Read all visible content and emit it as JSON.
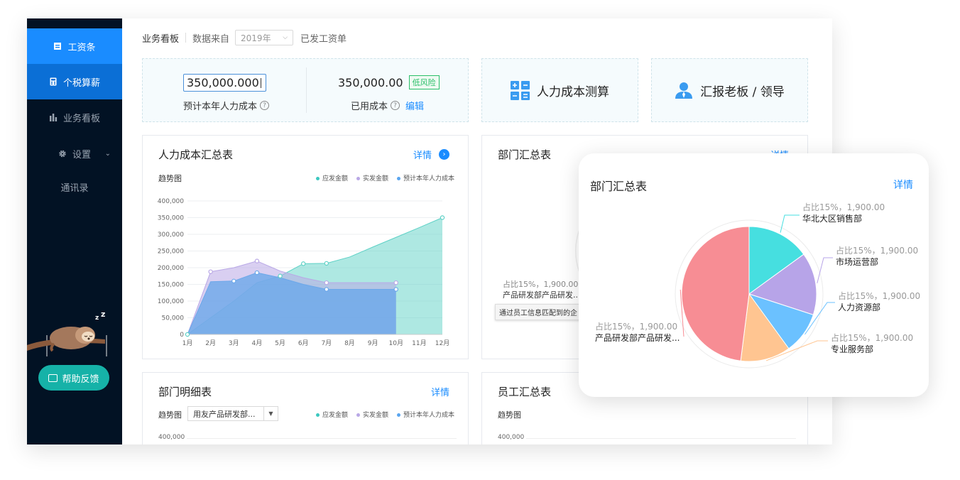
{
  "sidebar": {
    "items": [
      {
        "label": "工资条",
        "icon": "payslip-icon"
      },
      {
        "label": "个税算薪",
        "icon": "calculator-icon"
      },
      {
        "label": "业务看板",
        "icon": "bar-chart-icon"
      },
      {
        "label": "设置",
        "icon": "gear-icon"
      },
      {
        "label": "通讯录",
        "icon": ""
      }
    ],
    "help_label": "帮助反馈"
  },
  "topbar": {
    "title": "业务看板",
    "source_label": "数据来自",
    "year": "2019年",
    "paid_label": "已发工资单"
  },
  "summary": {
    "estimate_value": "350,000.000",
    "estimate_label": "预计本年人力成本",
    "used_value": "350,000.00",
    "risk_badge": "低风险",
    "used_label": "已用成本",
    "edit_label": "编辑",
    "calc_label": "人力成本测算",
    "report_label": "汇报老板 / 领导"
  },
  "cost_card": {
    "title": "人力成本汇总表",
    "detail": "详情",
    "subtitle": "趋势图",
    "legend": [
      "应发金额",
      "实发金额",
      "预计本年人力成本"
    ]
  },
  "dept_card": {
    "title": "部门汇总表",
    "detail": "详情",
    "pct_label": "占比15%，1,900.00",
    "name_label": "产品研发部产品研发...",
    "tooltip": "通过员工信息匹配到的企"
  },
  "dept_detail_card": {
    "title": "部门明细表",
    "detail": "详情",
    "subtitle": "趋势图",
    "select_value": "用友产品研发部...",
    "legend": [
      "应发金额",
      "实发金额",
      "预计本年人力成本"
    ],
    "y_top": "400,000"
  },
  "staff_card": {
    "title": "员工汇总表",
    "subtitle": "趋势图",
    "y_top": "400,000"
  },
  "popup": {
    "title": "部门汇总表",
    "detail": "详情"
  },
  "colors": {
    "sidebar_bg": "#021224",
    "active_blue": "#1a8cff",
    "help_green": "#16b2a8",
    "teal": "#5ed1c6",
    "purple": "#b9a8e6",
    "blue": "#6ca8ea"
  },
  "chart_data": [
    {
      "type": "area",
      "title": "人力成本汇总表",
      "subtitle": "趋势图",
      "categories": [
        "1月",
        "2月",
        "3月",
        "4月",
        "5月",
        "6月",
        "7月",
        "8月",
        "9月",
        "10月",
        "11月",
        "12月"
      ],
      "y_ticks": [
        "0",
        "50,000",
        "100,000",
        "150,000",
        "200,000",
        "250,000",
        "300,000",
        "350,000",
        "400,000"
      ],
      "ylim": [
        0,
        400000
      ],
      "series": [
        {
          "name": "应发金额",
          "color": "#b9a8e6",
          "values": [
            0,
            188000,
            200000,
            220000,
            190000,
            170000,
            155000,
            155000,
            155000,
            155000,
            null,
            null
          ]
        },
        {
          "name": "实发金额",
          "color": "#6ca8ea",
          "values": [
            0,
            158000,
            160000,
            185000,
            170000,
            150000,
            135000,
            135000,
            135000,
            135000,
            null,
            null
          ]
        },
        {
          "name": "预计本年人力成本",
          "color": "#5ed1c6",
          "values": [
            0,
            50000,
            100000,
            155000,
            175000,
            212000,
            213000,
            232000,
            262000,
            291000,
            320000,
            350000
          ]
        }
      ],
      "legend_position": "top-right",
      "grid": true
    },
    {
      "type": "pie",
      "title": "部门汇总表",
      "slices": [
        {
          "label": "华北大区销售部",
          "pct_label": "占比15%，1,900.00",
          "value": 1900,
          "share": 0.15,
          "color": "#46dfe0"
        },
        {
          "label": "市场运营部",
          "pct_label": "占比15%，1,900.00",
          "value": 1900,
          "share": 0.15,
          "color": "#b7a4e8"
        },
        {
          "label": "人力资源部",
          "pct_label": "占比15%，1,900.00",
          "value": 1900,
          "share": 0.1,
          "color": "#6bc1ff"
        },
        {
          "label": "专业服务部",
          "pct_label": "占比15%，1,900.00",
          "value": 1900,
          "share": 0.12,
          "color": "#ffc591"
        },
        {
          "label": "产品研发部产品研发...",
          "pct_label": "占比15%，1,900.00",
          "value": 1900,
          "share": 0.48,
          "color": "#f78d94"
        }
      ]
    }
  ]
}
